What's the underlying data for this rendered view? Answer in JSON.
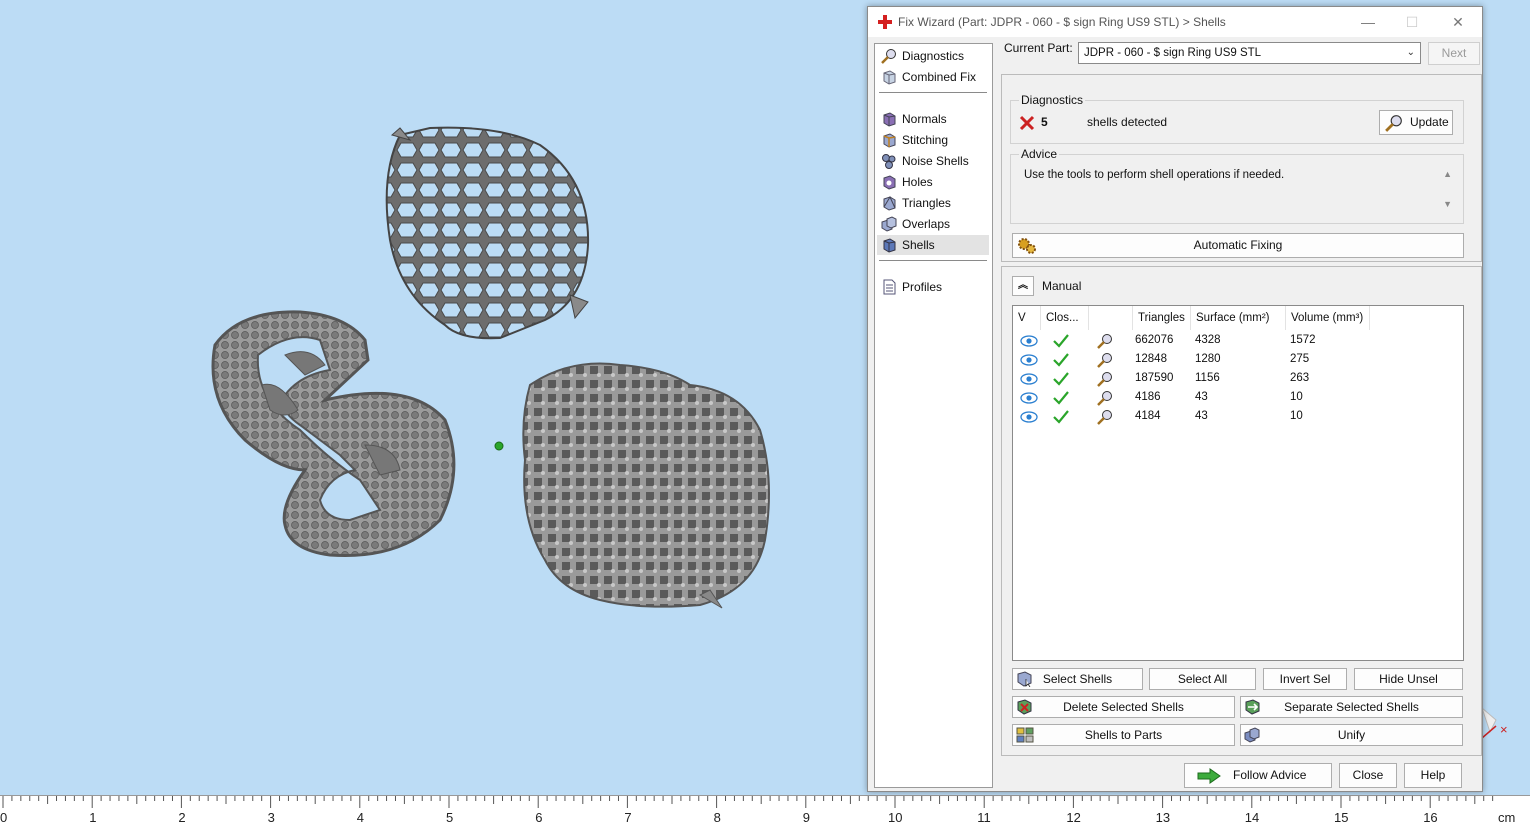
{
  "window": {
    "title": "Fix Wizard (Part: JDPR - 060 - $ sign Ring US9 STL) > Shells",
    "minimize": "—",
    "maximize": "☐",
    "close": "✕"
  },
  "nav": {
    "items": [
      {
        "label": "Diagnostics",
        "icon": "magnifier-icon"
      },
      {
        "label": "Combined Fix",
        "icon": "cube-icon"
      },
      {
        "label": "Normals",
        "icon": "normals-icon"
      },
      {
        "label": "Stitching",
        "icon": "stitching-icon"
      },
      {
        "label": "Noise Shells",
        "icon": "noise-shells-icon"
      },
      {
        "label": "Holes",
        "icon": "holes-icon"
      },
      {
        "label": "Triangles",
        "icon": "triangles-icon"
      },
      {
        "label": "Overlaps",
        "icon": "overlaps-icon"
      },
      {
        "label": "Shells",
        "icon": "shells-icon",
        "active": true
      },
      {
        "label": "Profiles",
        "icon": "document-icon"
      }
    ]
  },
  "current_part": {
    "label": "Current Part:",
    "value": "JDPR - 060 - $ sign Ring US9 STL",
    "next": "Next"
  },
  "diagnostics": {
    "group_title": "Diagnostics",
    "count": "5",
    "status_text": "shells detected",
    "update": "Update",
    "advice_title": "Advice",
    "advice_text": "Use the tools to perform shell operations if needed.",
    "automatic_fixing": "Automatic Fixing"
  },
  "manual": {
    "label": "Manual",
    "table": {
      "headers": [
        "V",
        "Clos...",
        "",
        "Triangles",
        "Surface (mm²)",
        "Volume (mm³)"
      ],
      "rows": [
        {
          "triangles": "662076",
          "surface": "4328",
          "volume": "1572"
        },
        {
          "triangles": "12848",
          "surface": "1280",
          "volume": "275"
        },
        {
          "triangles": "187590",
          "surface": "1156",
          "volume": "263"
        },
        {
          "triangles": "4186",
          "surface": "43",
          "volume": "10"
        },
        {
          "triangles": "4184",
          "surface": "43",
          "volume": "10"
        }
      ]
    },
    "buttons": {
      "select_shells": "Select Shells",
      "select_all": "Select All",
      "invert_sel": "Invert Sel",
      "hide_unsel": "Hide Unsel",
      "delete_selected": "Delete Selected Shells",
      "separate_selected": "Separate Selected Shells",
      "shells_to_parts": "Shells to Parts",
      "unify": "Unify"
    }
  },
  "footer": {
    "follow_advice": "Follow Advice",
    "close": "Close",
    "help": "Help"
  },
  "ruler": {
    "labels": [
      "0",
      "1",
      "2",
      "3",
      "4",
      "5",
      "6",
      "7",
      "8",
      "9",
      "10",
      "11",
      "12",
      "13",
      "14",
      "15",
      "16"
    ],
    "unit": "cm"
  },
  "colors": {
    "viewport_bg": "#bcdcf5",
    "model_gray": "#8c8c8c",
    "check_green": "#2aa52a",
    "error_red": "#cc2222"
  }
}
